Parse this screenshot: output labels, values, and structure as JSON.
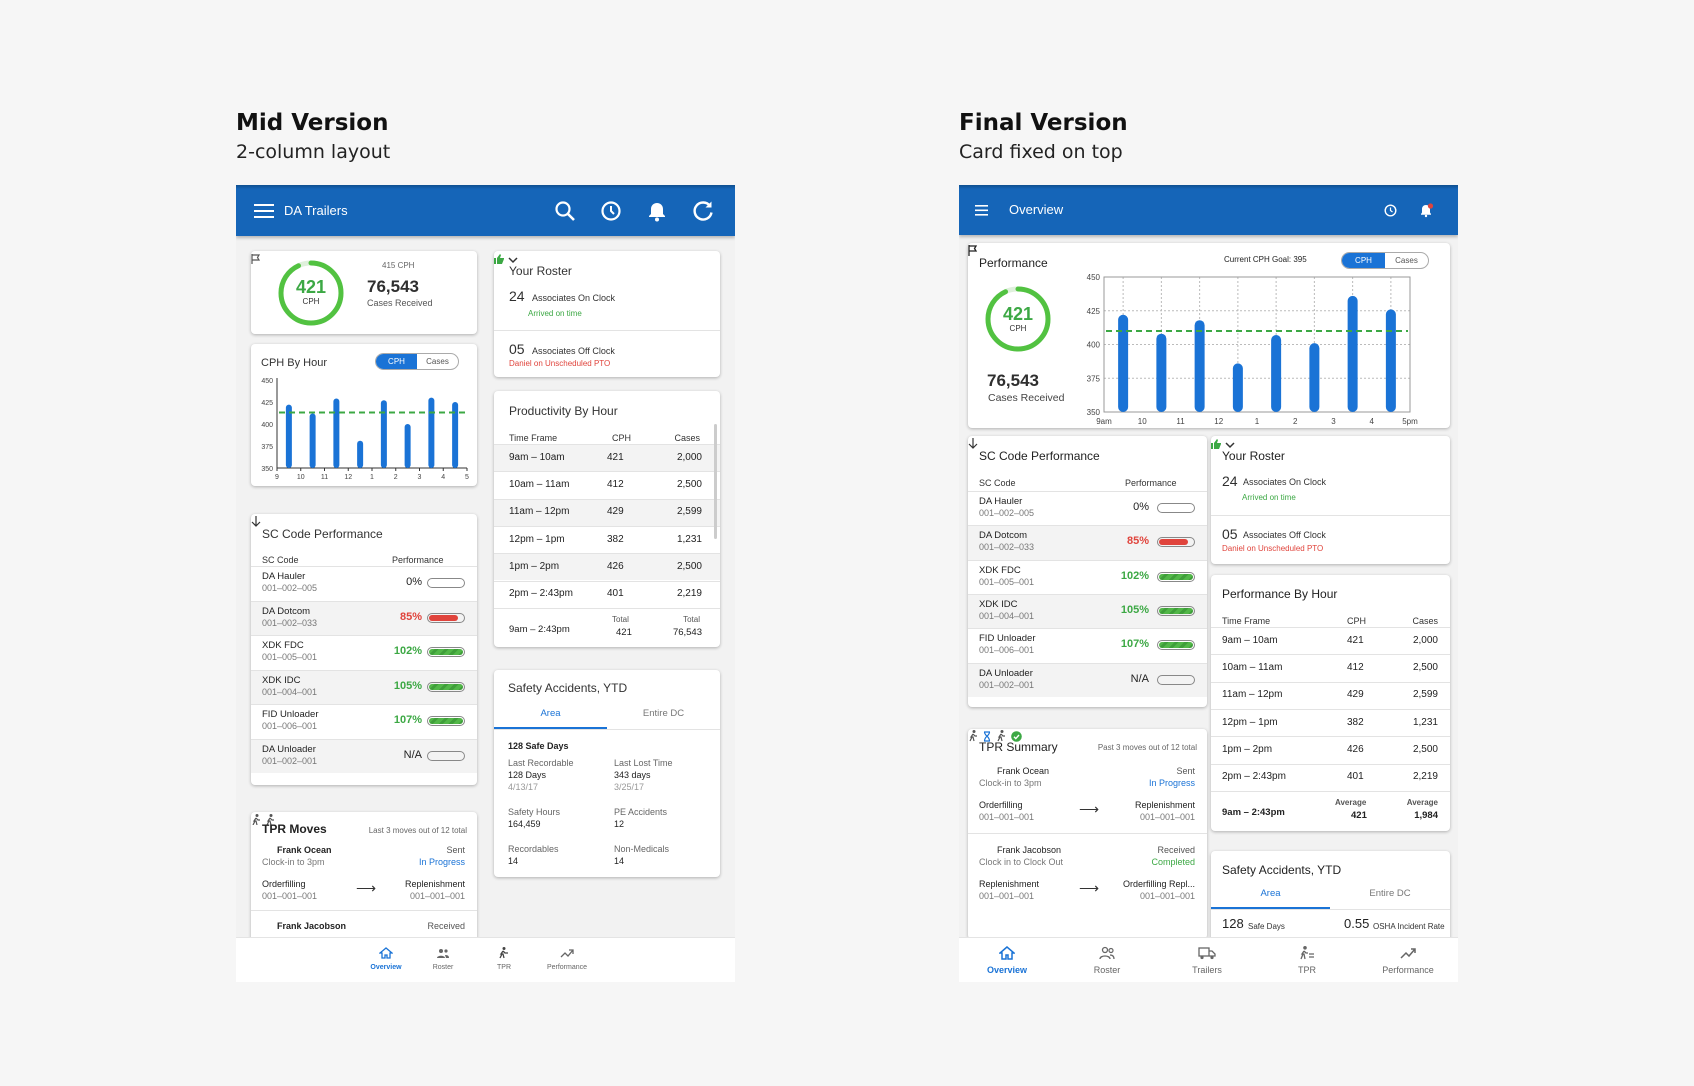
{
  "mid": {
    "heading": "Mid Version",
    "subheading": "2-column layout",
    "appbar_title": "DA Trailers",
    "summary": {
      "cph_value": "421",
      "cph_label": "CPH",
      "goal": "415 CPH",
      "cases_value": "76,543",
      "cases_label": "Cases Received",
      "progress": 0.93
    },
    "cph_chart": {
      "title": "CPH By Hour",
      "toggle_cph": "CPH",
      "toggle_cases": "Cases"
    },
    "sc_code": {
      "title": "SC Code Performance",
      "col_code": "SC Code",
      "col_perf": "Performance",
      "rows": [
        {
          "name": "DA Hauler",
          "code": "001–002–005",
          "pct": "0%",
          "value": 0,
          "status": "none"
        },
        {
          "name": "DA Dotcom",
          "code": "001–002–033",
          "pct": "85%",
          "value": 0.85,
          "status": "red"
        },
        {
          "name": "XDK FDC",
          "code": "001–005–001",
          "pct": "102%",
          "value": 1.0,
          "status": "green"
        },
        {
          "name": "XDK IDC",
          "code": "001–004–001",
          "pct": "105%",
          "value": 1.0,
          "status": "green"
        },
        {
          "name": "FID Unloader",
          "code": "001–006–001",
          "pct": "107%",
          "value": 1.0,
          "status": "green"
        },
        {
          "name": "DA Unloader",
          "code": "001–002–001",
          "pct": "N/A",
          "value": 0,
          "status": "none"
        }
      ]
    },
    "tpr": {
      "title": "TPR Moves",
      "meta": "Last 3 moves out of 12 total",
      "moves": [
        {
          "person": "Frank Ocean",
          "shift": "Clock-in to 3pm",
          "status_label": "Sent",
          "status": "In Progress",
          "from": "Orderfilling",
          "from_code": "001–001–001",
          "to": "Replenishment",
          "to_code": "001–001–001"
        },
        {
          "person": "Frank Jacobson",
          "status_label": "Received"
        }
      ]
    },
    "roster": {
      "title": "Your Roster",
      "on_count": "24",
      "on_label": "Associates On Clock",
      "on_note": "Arrived on time",
      "off_count": "05",
      "off_label": "Associates Off Clock",
      "off_note": "Daniel on Unscheduled PTO"
    },
    "productivity": {
      "title": "Productivity By Hour",
      "headers": [
        "Time Frame",
        "CPH",
        "Cases"
      ],
      "total_label": "Total",
      "total_total_label": "Total",
      "total": {
        "frame": "9am – 2:43pm",
        "cph": "421",
        "cases": "76,543"
      }
    },
    "safety": {
      "title": "Safety Accidents, YTD",
      "tabs": [
        "Area",
        "Entire DC"
      ],
      "safe_days": "128 Safe Days",
      "stats": [
        {
          "label": "Last Recordable",
          "value": "128 Days",
          "sub": "4/13/17"
        },
        {
          "label": "Last Lost Time",
          "value": "343 days",
          "sub": "3/25/17"
        },
        {
          "label": "Safety Hours",
          "value": "164,459",
          "sub": ""
        },
        {
          "label": "PE Accidents",
          "value": "12",
          "sub": ""
        },
        {
          "label": "Recordables",
          "value": "14",
          "sub": ""
        },
        {
          "label": "Non-Medicals",
          "value": "14",
          "sub": ""
        }
      ]
    },
    "nav": [
      "Overview",
      "Roster",
      "TPR",
      "Performance"
    ]
  },
  "final": {
    "heading": "Final Version",
    "subheading": "Card fixed on top",
    "appbar_title": "Overview",
    "performance": {
      "title": "Performance",
      "goal": "Current CPH Goal: 395",
      "toggle_cph": "CPH",
      "toggle_cases": "Cases",
      "cph_value": "421",
      "cph_label": "CPH",
      "cases_value": "76,543",
      "cases_label": "Cases Received",
      "progress": 0.93
    },
    "sc_code": {
      "title": "SC Code Performance",
      "col_code": "SC Code",
      "col_perf": "Performance",
      "rows": [
        {
          "name": "DA Hauler",
          "code": "001–002–005",
          "pct": "0%",
          "value": 0,
          "status": "none"
        },
        {
          "name": "DA Dotcom",
          "code": "001–002–033",
          "pct": "85%",
          "value": 0.85,
          "status": "red"
        },
        {
          "name": "XDK FDC",
          "code": "001–005–001",
          "pct": "102%",
          "value": 1.0,
          "status": "green"
        },
        {
          "name": "XDK IDC",
          "code": "001–004–001",
          "pct": "105%",
          "value": 1.0,
          "status": "green"
        },
        {
          "name": "FID Unloader",
          "code": "001–006–001",
          "pct": "107%",
          "value": 1.0,
          "status": "green"
        },
        {
          "name": "DA Unloader",
          "code": "001–002–001",
          "pct": "N/A",
          "value": 0,
          "status": "none"
        }
      ]
    },
    "tpr": {
      "title": "TPR Summary",
      "meta": "Past 3 moves out of 12 total",
      "moves": [
        {
          "person": "Frank Ocean",
          "shift": "Clock-in to 3pm",
          "status_label": "Sent",
          "status": "In Progress",
          "from": "Orderfilling",
          "from_code": "001–001–001",
          "to": "Replenishment",
          "to_code": "001–001–001"
        },
        {
          "person": "Frank Jacobson",
          "shift": "Clock in to Clock Out",
          "status_label": "Received",
          "status": "Completed",
          "from": "Replenishment",
          "from_code": "001–001–001",
          "to": "Orderfilling Repl...",
          "to_code": "001–001–001"
        }
      ]
    },
    "roster": {
      "title": "Your Roster",
      "on_count": "24",
      "on_label": "Associates On Clock",
      "on_note": "Arrived on time",
      "off_count": "05",
      "off_label": "Associates Off Clock",
      "off_note": "Daniel on Unscheduled PTO"
    },
    "perf_hour": {
      "title": "Performance By Hour",
      "headers": [
        "Time Frame",
        "CPH",
        "Cases"
      ],
      "total_label": "Average",
      "total_total_label": "Average",
      "total": {
        "frame": "9am – 2:43pm",
        "cph": "421",
        "cases": "1,984"
      }
    },
    "safety": {
      "title": "Safety Accidents, YTD",
      "tabs": [
        "Area",
        "Entire DC"
      ],
      "safe_days_value": "128",
      "safe_days_label": "Safe Days",
      "osha_value": "0.55",
      "osha_label": "OSHA Incident Rate"
    },
    "nav": [
      "Overview",
      "Roster",
      "Trailers",
      "TPR",
      "Performance"
    ]
  },
  "hourly_rows": [
    {
      "frame": "9am – 10am",
      "cph": "421",
      "cases": "2,000"
    },
    {
      "frame": "10am – 11am",
      "cph": "412",
      "cases": "2,500"
    },
    {
      "frame": "11am – 12pm",
      "cph": "429",
      "cases": "2,599"
    },
    {
      "frame": "12pm – 1pm",
      "cph": "382",
      "cases": "1,231"
    },
    {
      "frame": "1pm – 2pm",
      "cph": "426",
      "cases": "2,500"
    },
    {
      "frame": "2pm – 2:43pm",
      "cph": "401",
      "cases": "2,219"
    }
  ],
  "chart_data": [
    {
      "type": "bar",
      "title": "CPH By Hour",
      "categories": [
        "9",
        "10",
        "11",
        "12",
        "1",
        "2",
        "3",
        "4",
        "5"
      ],
      "values": [
        422,
        412,
        429,
        381,
        427,
        400,
        430,
        425
      ],
      "goal": 413,
      "yticks": [
        350,
        375,
        400,
        425,
        450
      ],
      "ylim": [
        350,
        450
      ],
      "grid": false
    },
    {
      "type": "bar",
      "title": "Performance",
      "categories": [
        "9am",
        "10",
        "11",
        "12",
        "1",
        "2",
        "3",
        "4",
        "5pm"
      ],
      "values": [
        422,
        408,
        418,
        386,
        407,
        401,
        436,
        426
      ],
      "goal": 410,
      "yticks": [
        350,
        375,
        400,
        425,
        450
      ],
      "ylim": [
        350,
        450
      ],
      "grid": true
    }
  ],
  "colors": {
    "appbar": "#1565b8",
    "accent": "#1a73d6",
    "green": "#3ca844",
    "red": "#e0443c"
  }
}
